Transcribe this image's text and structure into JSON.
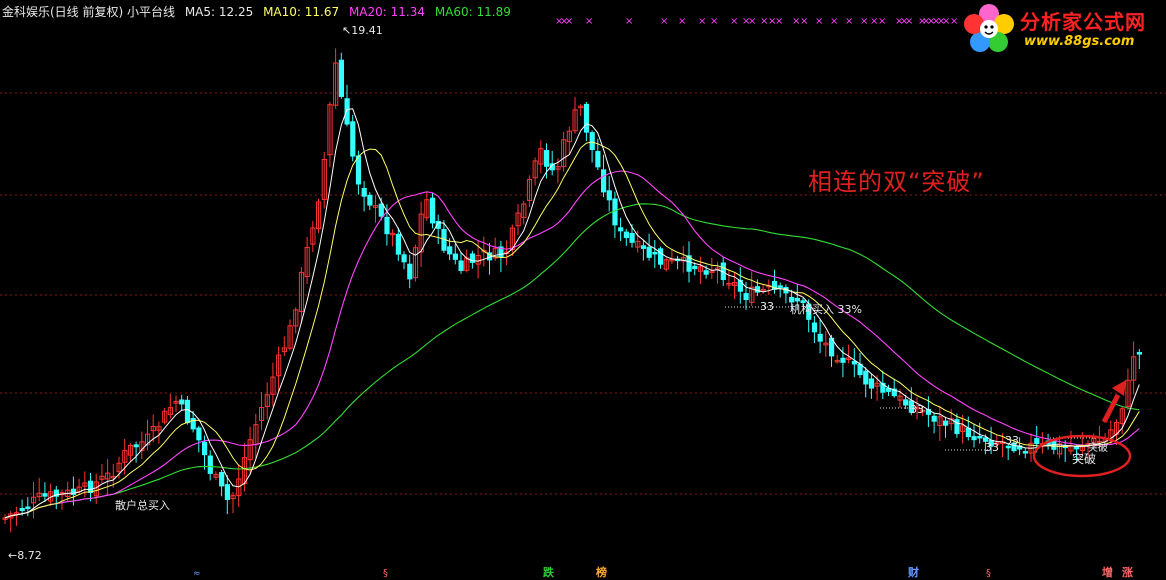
{
  "header": {
    "title": "金科娱乐(日线 前复权) 小平台线",
    "ma5": "MA5: 12.25",
    "ma10": "MA10: 11.67",
    "ma20": "MA20: 11.34",
    "ma60": "MA60: 11.89"
  },
  "logo": {
    "name": "分析家公式网",
    "url": "www.88gs.com",
    "icon": "flower-icon"
  },
  "annotation": "相连的双“突破”",
  "price_high": "19.41",
  "price_low": "8.72",
  "labels": {
    "retail_buy": "散户总买入",
    "inst_buy": "机构买入 33%",
    "breakout": "突破",
    "n33": "33"
  },
  "bottom_markers": [
    "跌",
    "榜",
    "财",
    "增",
    "涨"
  ],
  "colors": {
    "up": "#ff3333",
    "down": "#33ffff",
    "ma5": "#ffffff",
    "ma10": "#ffff66",
    "ma20": "#ff44ff",
    "ma60": "#33dd33",
    "annotation": "#e02020"
  },
  "chart_data": {
    "type": "candlestick",
    "price_range": [
      8.72,
      19.41
    ],
    "series": [
      {
        "name": "MA5",
        "values": [
          12.25
        ]
      },
      {
        "name": "MA10",
        "values": [
          11.67
        ]
      },
      {
        "name": "MA20",
        "values": [
          11.34
        ]
      },
      {
        "name": "MA60",
        "values": [
          11.89
        ]
      }
    ]
  }
}
